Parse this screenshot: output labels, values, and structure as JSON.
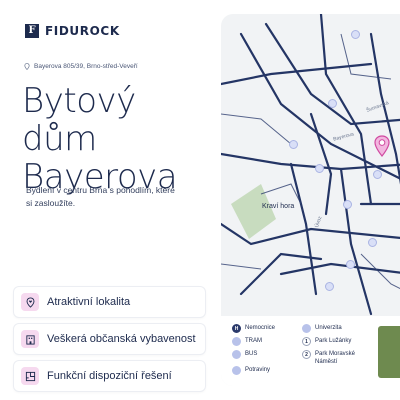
{
  "brand": {
    "name": "FIDUROCK",
    "mark": "F"
  },
  "address": "Bayerova 805/39, Brno-střed-Veveří",
  "title": {
    "line1": "Bytový dům",
    "line2": "Bayerova"
  },
  "lead": "Bydlení v centru Brna s pohodlím, které si zasloužíte.",
  "features": [
    {
      "label": "Atraktivní lokalita",
      "icon": "location-heart-icon"
    },
    {
      "label": "Veškerá občanská vybavenost",
      "icon": "building-icon"
    },
    {
      "label": "Funkční dispoziční řešení",
      "icon": "floorplan-icon"
    }
  ],
  "map": {
    "park_label": "Kraví hora",
    "street_labels": [
      "Úvoz",
      "Bayerova",
      "Šumavská"
    ],
    "legend": [
      {
        "icon_text": "H",
        "label": "Nemocnice"
      },
      {
        "icon_text": "",
        "label": "Univerzita"
      },
      {
        "icon_text": "",
        "label": "TRAM"
      },
      {
        "icon_text": "1",
        "label": "Park Lužánky"
      },
      {
        "icon_text": "",
        "label": "BUS"
      },
      {
        "icon_text": "2",
        "label": "Park Moravské Náměstí"
      },
      {
        "icon_text": "",
        "label": "Potraviny"
      }
    ]
  },
  "colors": {
    "navy": "#1d2a4d",
    "accent_pink": "#f6d9ef",
    "map_bg": "#f1f3f5",
    "pin": "#d04aa0"
  }
}
